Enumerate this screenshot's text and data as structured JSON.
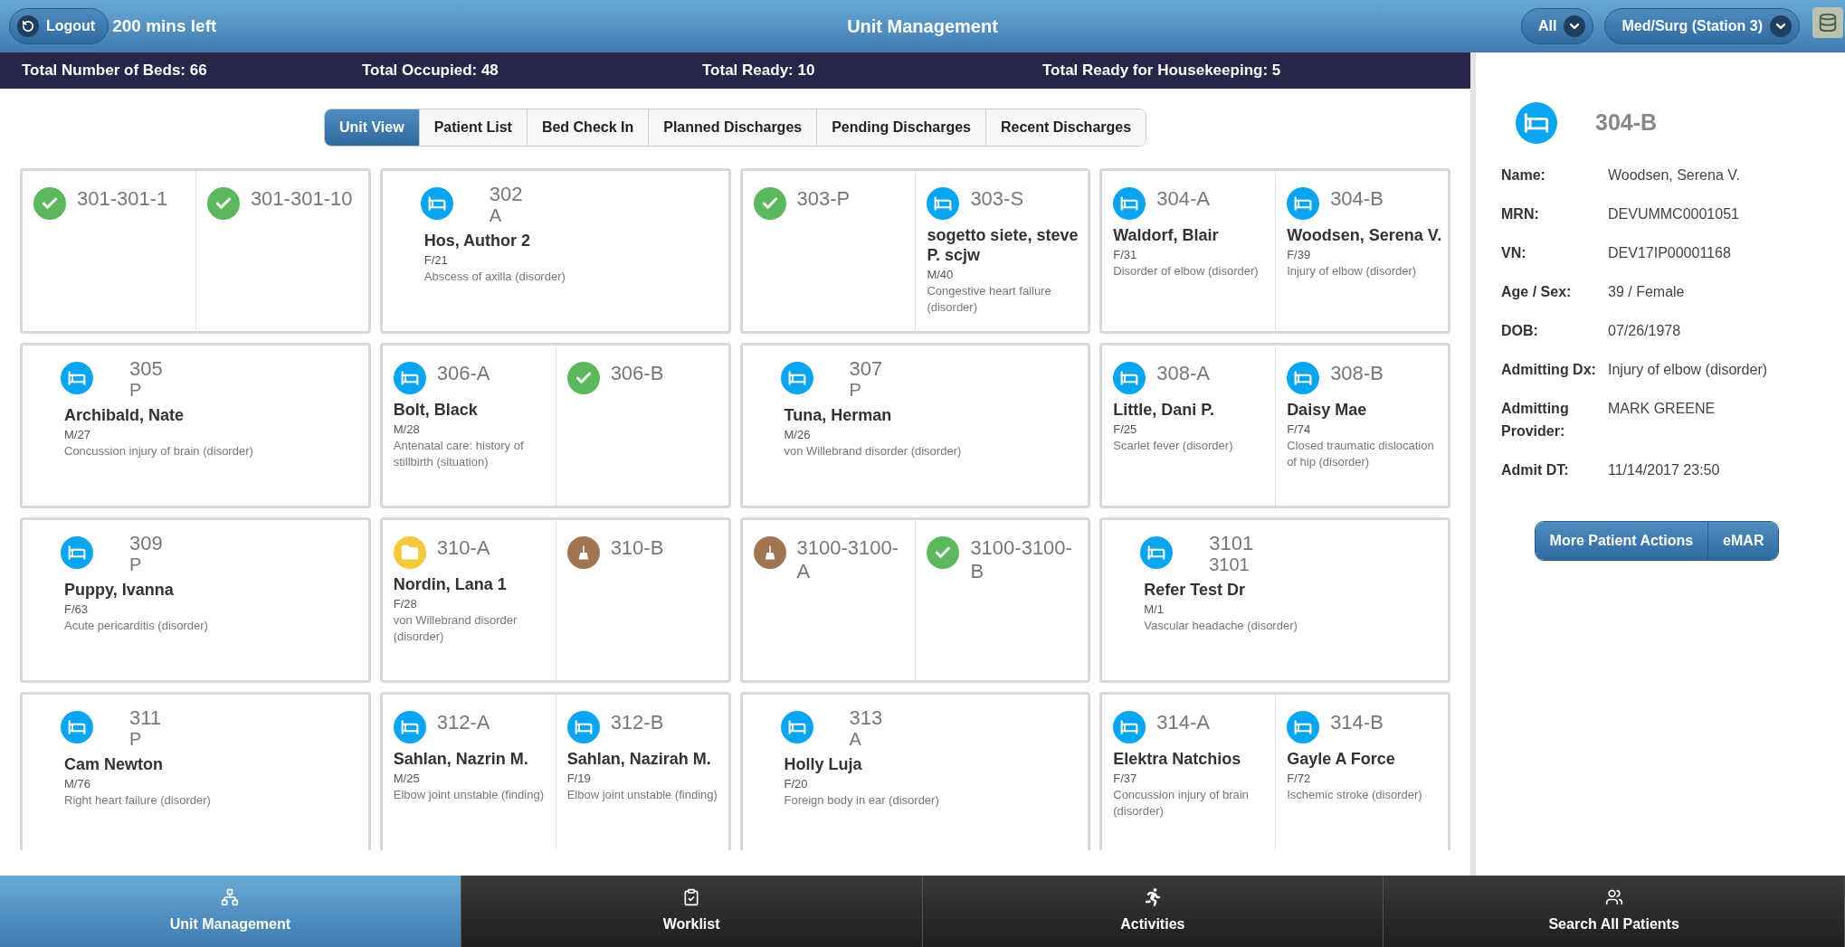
{
  "header": {
    "logout": "Logout",
    "time_left": "200 mins left",
    "title": "Unit Management",
    "filters": [
      {
        "label": "All"
      },
      {
        "label": "Med/Surg (Station 3)"
      }
    ]
  },
  "stats": [
    "Total Number of Beds: 66",
    "Total Occupied: 48",
    "Total Ready: 10",
    "Total Ready for Housekeeping: 5"
  ],
  "tabs": [
    {
      "label": "Unit View",
      "selected": true
    },
    {
      "label": "Patient List",
      "selected": false
    },
    {
      "label": "Bed Check In",
      "selected": false
    },
    {
      "label": "Planned Discharges",
      "selected": false
    },
    {
      "label": "Pending Discharges",
      "selected": false
    },
    {
      "label": "Recent Discharges",
      "selected": false
    }
  ],
  "cards": [
    {
      "beds": [
        {
          "kind": "ready",
          "id": "301-301-1"
        },
        {
          "kind": "ready",
          "id": "301-301-10"
        }
      ]
    },
    {
      "beds": [
        {
          "kind": "occupied",
          "id": "302",
          "sub": "A",
          "name": "Hos, Author 2",
          "info": "F/21",
          "dx": "Abscess of axilla (disorder)"
        }
      ]
    },
    {
      "beds": [
        {
          "kind": "ready",
          "id": "303-P"
        },
        {
          "kind": "occupied",
          "id": "303-S",
          "name": "sogetto siete, steve P. scjw",
          "info": "M/40",
          "dx": "Congestive heart failure (disorder)"
        }
      ]
    },
    {
      "beds": [
        {
          "kind": "occupied",
          "id": "304-A",
          "name": "Waldorf, Blair",
          "info": "F/31",
          "dx": "Disorder of elbow (disorder)"
        },
        {
          "kind": "occupied",
          "id": "304-B",
          "name": "Woodsen, Serena V.",
          "info": "F/39",
          "dx": "Injury of elbow (disorder)"
        }
      ]
    },
    {
      "beds": [
        {
          "kind": "occupied",
          "id": "305",
          "sub": "P",
          "name": "Archibald, Nate",
          "info": "M/27",
          "dx": "Concussion injury of brain (disorder)"
        }
      ]
    },
    {
      "beds": [
        {
          "kind": "occupied",
          "id": "306-A",
          "name": "Bolt, Black",
          "info": "M/28",
          "dx": "Antenatal care: history of stillbirth (situation)"
        },
        {
          "kind": "ready",
          "id": "306-B"
        }
      ]
    },
    {
      "beds": [
        {
          "kind": "occupied",
          "id": "307",
          "sub": "P",
          "name": "Tuna, Herman",
          "info": "M/26",
          "dx": "von Willebrand disorder (disorder)"
        }
      ]
    },
    {
      "beds": [
        {
          "kind": "occupied",
          "id": "308-A",
          "name": "Little, Dani P.",
          "info": "F/25",
          "dx": "Scarlet fever (disorder)"
        },
        {
          "kind": "occupied",
          "id": "308-B",
          "name": "Daisy Mae",
          "info": "F/74",
          "dx": "Closed traumatic dislocation of hip (disorder)"
        }
      ]
    },
    {
      "beds": [
        {
          "kind": "occupied",
          "id": "309",
          "sub": "P",
          "name": "Puppy, Ivanna",
          "info": "F/63",
          "dx": "Acute pericarditis (disorder)"
        }
      ]
    },
    {
      "beds": [
        {
          "kind": "pending",
          "id": "310-A",
          "name": "Nordin, Lana 1",
          "info": "F/28",
          "dx": "von Willebrand disorder (disorder)"
        },
        {
          "kind": "cleaning",
          "id": "310-B"
        }
      ]
    },
    {
      "beds": [
        {
          "kind": "cleaning",
          "id": "3100-3100-A"
        },
        {
          "kind": "ready",
          "id": "3100-3100-B"
        }
      ]
    },
    {
      "beds": [
        {
          "kind": "occupied",
          "id": "3101",
          "sub": "3101",
          "name": "Refer Test Dr",
          "info": "M/1",
          "dx": "Vascular headache (disorder)"
        }
      ]
    },
    {
      "beds": [
        {
          "kind": "occupied",
          "id": "311",
          "sub": "P",
          "name": "Cam Newton",
          "info": "M/76",
          "dx": "Right heart failure (disorder)"
        }
      ]
    },
    {
      "beds": [
        {
          "kind": "occupied",
          "id": "312-A",
          "name": "Sahlan, Nazrin M.",
          "info": "M/25",
          "dx": "Elbow joint unstable (finding)"
        },
        {
          "kind": "occupied",
          "id": "312-B",
          "name": "Sahlan, Nazirah M.",
          "info": "F/19",
          "dx": "Elbow joint unstable (finding)"
        }
      ]
    },
    {
      "beds": [
        {
          "kind": "occupied",
          "id": "313",
          "sub": "A",
          "name": "Holly Luja",
          "info": "F/20",
          "dx": "Foreign body in ear (disorder)"
        }
      ]
    },
    {
      "beds": [
        {
          "kind": "occupied",
          "id": "314-A",
          "name": "Elektra Natchios",
          "info": "F/37",
          "dx": "Concussion injury of brain (disorder)"
        },
        {
          "kind": "occupied",
          "id": "314-B",
          "name": "Gayle A Force",
          "info": "F/72",
          "dx": "Ischemic stroke (disorder)"
        }
      ]
    }
  ],
  "detail": {
    "kind": "occupied",
    "bed": "304-B",
    "fields": [
      {
        "label": "Name:",
        "value": "Woodsen, Serena V."
      },
      {
        "label": "MRN:",
        "value": "DEVUMMC0001051"
      },
      {
        "label": "VN:",
        "value": "DEV17IP00001168"
      },
      {
        "label": "Age / Sex:",
        "value": "39 / Female"
      },
      {
        "label": "DOB:",
        "value": "07/26/1978"
      },
      {
        "label": "Admitting Dx:",
        "value": "Injury of elbow (disorder)"
      },
      {
        "label": "Admitting Provider:",
        "value": "MARK GREENE"
      },
      {
        "label": "Admit DT:",
        "value": "11/14/2017 23:50"
      }
    ],
    "actions": [
      "More Patient Actions",
      "eMAR"
    ]
  },
  "nav": [
    {
      "label": "Unit Management",
      "selected": true,
      "kind": "unit"
    },
    {
      "label": "Worklist",
      "selected": false,
      "kind": "worklist"
    },
    {
      "label": "Activities",
      "selected": false,
      "kind": "activities"
    },
    {
      "label": "Search All Patients",
      "selected": false,
      "kind": "search"
    }
  ]
}
